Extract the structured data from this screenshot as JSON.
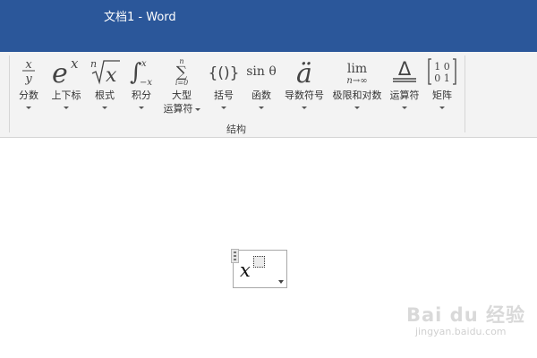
{
  "window": {
    "title": "文档1 - Word"
  },
  "ribbon": {
    "group_label": "结构",
    "tools": [
      {
        "id": "fraction",
        "label": "分数",
        "icon": "fraction-icon"
      },
      {
        "id": "script",
        "label": "上下标",
        "icon": "script-icon"
      },
      {
        "id": "radical",
        "label": "根式",
        "icon": "radical-icon"
      },
      {
        "id": "integral",
        "label": "积分",
        "icon": "integral-icon"
      },
      {
        "id": "large-operator",
        "label": "大型",
        "label2": "运算符",
        "icon": "large-operator-icon"
      },
      {
        "id": "bracket",
        "label": "括号",
        "icon": "bracket-icon"
      },
      {
        "id": "function",
        "label": "函数",
        "icon": "function-icon"
      },
      {
        "id": "accent",
        "label": "导数符号",
        "icon": "accent-icon"
      },
      {
        "id": "limit-log",
        "label": "极限和对数",
        "icon": "limit-icon"
      },
      {
        "id": "operator",
        "label": "运算符",
        "icon": "operator-icon"
      },
      {
        "id": "matrix",
        "label": "矩阵",
        "icon": "matrix-icon"
      }
    ],
    "icon_text": {
      "fraction_num": "x",
      "fraction_den": "y",
      "script_base": "e",
      "script_sup": "x",
      "radical_index": "n",
      "radical_base": "x",
      "integral_upper": "x",
      "integral_lower": "−x",
      "sum_top": "n",
      "sum_bottom": "i=0",
      "bracket": "{()}",
      "function": "sin θ",
      "accent": "ä",
      "limit_top": "lim",
      "limit_bottom": "n→∞",
      "operator": "Δ",
      "matrix_row1": "1 0",
      "matrix_row2": "0 1"
    }
  },
  "equation": {
    "base": "x"
  },
  "watermark": {
    "text": "Bai du 经验",
    "url": "jingyan.baidu.com"
  },
  "colors": {
    "titlebar": "#2b579a",
    "ribbon": "#f3f3f3"
  }
}
